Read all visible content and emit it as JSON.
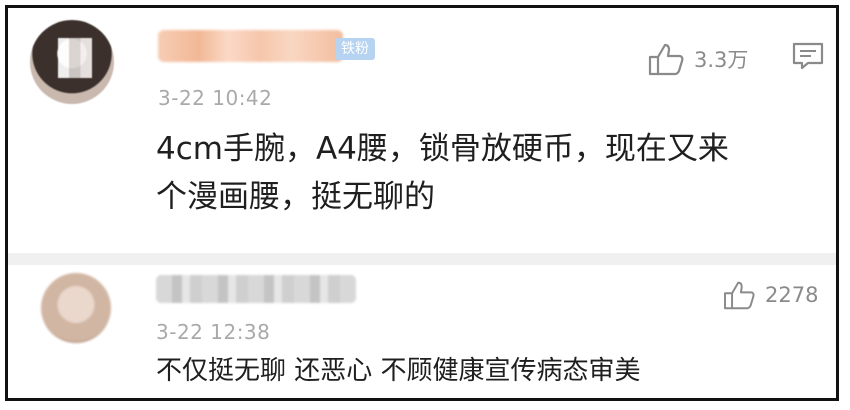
{
  "comments": [
    {
      "badge": "铁粉",
      "time": "3-22 10:42",
      "likes": "3.3万",
      "text": "4cm手腕，A4腰，锁骨放硬币，现在又来个漫画腰，挺无聊的",
      "text_lines": [
        "4cm手腕，A4腰，锁骨放硬币，现在又来",
        "个漫画腰，挺无聊的"
      ]
    },
    {
      "time": "3-22 12:38",
      "likes": "2278",
      "text": "不仅挺无聊 还恶心 不顾健康宣传病态审美"
    }
  ],
  "icons": {
    "like": "thumbs-up-icon",
    "reply": "comment-icon"
  },
  "colors": {
    "text": "#1f1f1f",
    "meta": "#a9a9a9",
    "badge_bg": "#b7d3f2",
    "separator": "#f0f0f0"
  }
}
